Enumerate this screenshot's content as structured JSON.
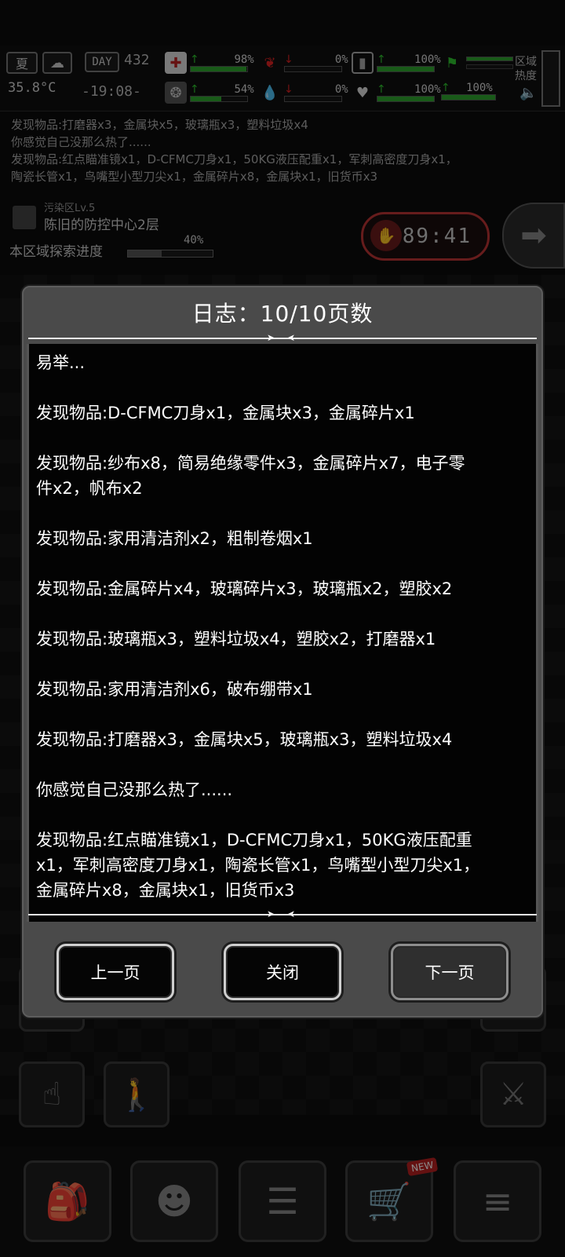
{
  "status": {
    "season": "夏",
    "day_label": "DAY",
    "day_num": "432",
    "temperature": "35.8°C",
    "time": "-19:08-",
    "stats": [
      {
        "name": "health",
        "icon": "medkit-icon",
        "pct": "98%",
        "value": 0.98,
        "trend": "up"
      },
      {
        "name": "sanity",
        "icon": "brain-icon",
        "pct": "54%",
        "value": 0.54,
        "trend": "up"
      },
      {
        "name": "hunger",
        "icon": "stomach-icon",
        "pct": "0%",
        "value": 0.0,
        "trend": "down"
      },
      {
        "name": "thirst",
        "icon": "water-drop-icon",
        "pct": "0%",
        "value": 0.0,
        "trend": "down"
      },
      {
        "name": "stamina",
        "icon": "battery-icon",
        "pct": "100%",
        "value": 1.0,
        "trend": "up"
      },
      {
        "name": "mood",
        "icon": "heart-icon",
        "pct": "100%",
        "value": 1.0,
        "trend": "up"
      },
      {
        "name": "exercise",
        "icon": "figure-icon",
        "pct": "",
        "value": 1.0,
        "trend": ""
      },
      {
        "name": "load",
        "icon": "weight-icon",
        "pct": "100%",
        "value": 1.0,
        "trend": "up"
      }
    ],
    "zone_heat_label": "区域热度"
  },
  "background_log": [
    "发现物品:打磨器x3，金属块x5，玻璃瓶x3，塑料垃圾x4",
    "你感觉自己没那么热了......",
    "发现物品:红点瞄准镜x1，D-CFMC刀身x1，50KG液压配重x1，军刺高密度刀身x1，",
    "陶瓷长管x1，鸟嘴型小型刀尖x1，金属碎片x8，金属块x1，旧货币x3"
  ],
  "zone": {
    "level": "污染区Lv.5",
    "name": "陈旧的防控中心2层",
    "progress_label": "本区域探索进度",
    "progress_pct": "40%",
    "progress_value": 0.4,
    "timer": "89:41"
  },
  "dialog": {
    "title": "日志：10/10页数",
    "entries": [
      "易举...",
      "发现物品:D-CFMC刀身x1，金属块x3，金属碎片x1",
      "发现物品:纱布x8，简易绝缘零件x3，金属碎片x7，电子零\n件x2，帆布x2",
      "发现物品:家用清洁剂x2，粗制卷烟x1",
      "发现物品:金属碎片x4，玻璃碎片x3，玻璃瓶x2，塑胶x2",
      "发现物品:玻璃瓶x3，塑料垃圾x4，塑胶x2，打磨器x1",
      "发现物品:家用清洁剂x6，破布绷带x1",
      "发现物品:打磨器x3，金属块x5，玻璃瓶x3，塑料垃圾x4",
      "你感觉自己没那么热了......",
      "发现物品:红点瞄准镜x1，D-CFMC刀身x1，50KG液压配重\nx1，军刺高密度刀身x1，陶瓷长管x1，鸟嘴型小型刀尖x1，\n金属碎片x8，金属块x1，旧货币x3"
    ],
    "prev_label": "上一页",
    "close_label": "关闭",
    "next_label": "下一页"
  },
  "bottom_nav": {
    "items": [
      "backpack-icon",
      "brain-icon",
      "journal-icon",
      "shop-cart-icon",
      "menu-list-icon"
    ],
    "shop_badge": "NEW"
  },
  "colors": {
    "dialog_bg": "#4a4a4a",
    "text_bg": "#030303",
    "positive": "#2fa52f",
    "negative": "#d22222",
    "timer_border": "#b33333"
  }
}
